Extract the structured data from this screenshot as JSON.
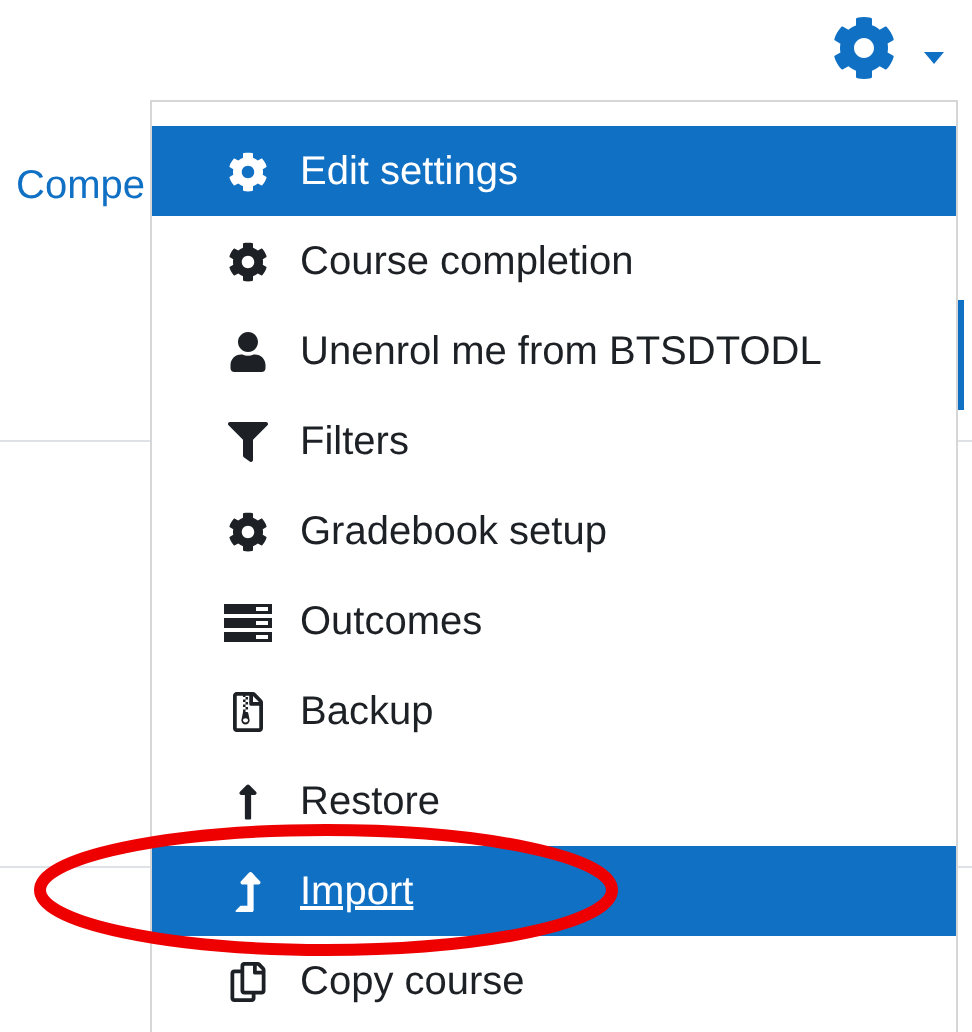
{
  "page_link": "Compe",
  "menu": {
    "items": [
      {
        "label": "Edit settings",
        "kind": "gear",
        "highlighted": true,
        "underlined": false
      },
      {
        "label": "Course completion",
        "kind": "gear",
        "highlighted": false,
        "underlined": false
      },
      {
        "label": "Unenrol me from BTSDTODL",
        "kind": "user",
        "highlighted": false,
        "underlined": false
      },
      {
        "label": "Filters",
        "kind": "filter",
        "highlighted": false,
        "underlined": false
      },
      {
        "label": "Gradebook setup",
        "kind": "gear",
        "highlighted": false,
        "underlined": false
      },
      {
        "label": "Outcomes",
        "kind": "bars",
        "highlighted": false,
        "underlined": false
      },
      {
        "label": "Backup",
        "kind": "archive",
        "highlighted": false,
        "underlined": false
      },
      {
        "label": "Restore",
        "kind": "up",
        "highlighted": false,
        "underlined": false
      },
      {
        "label": "Import",
        "kind": "levelup",
        "highlighted": true,
        "underlined": true
      },
      {
        "label": "Copy course",
        "kind": "copy",
        "highlighted": false,
        "underlined": false
      }
    ]
  }
}
